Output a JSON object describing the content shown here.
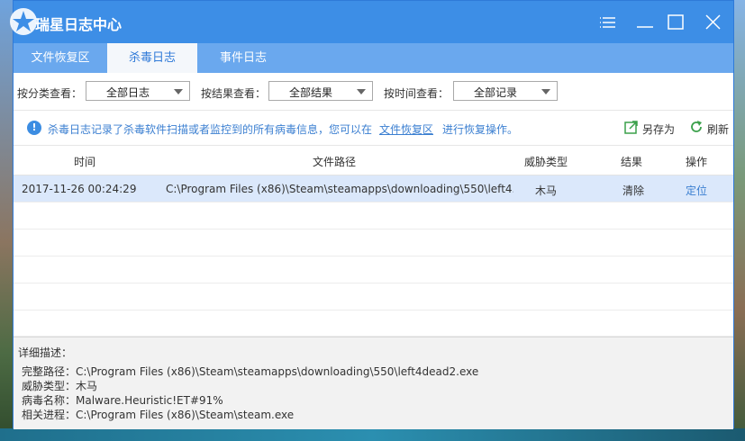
{
  "window": {
    "title": "瑞星日志中心",
    "controls": [
      "menu-icon",
      "minimize-icon",
      "maximize-icon",
      "close-icon"
    ]
  },
  "tabs": [
    {
      "label": "文件恢复区",
      "active": false
    },
    {
      "label": "杀毒日志",
      "active": true
    },
    {
      "label": "事件日志",
      "active": false
    }
  ],
  "filters": {
    "category": {
      "label": "按分类查看：",
      "value": "全部日志"
    },
    "result": {
      "label": "按结果查看：",
      "value": "全部结果"
    },
    "time": {
      "label": "按时间查看：",
      "value": "全部记录"
    }
  },
  "info": {
    "text": "杀毒日志记录了杀毒软件扫描或者监控到的所有病毒信息，您可以在",
    "link": "文件恢复区",
    "tail": "进行恢复操作。",
    "save_as": "另存为",
    "refresh": "刷新"
  },
  "table": {
    "columns": [
      "时间",
      "文件路径",
      "威胁类型",
      "结果",
      "操作"
    ],
    "rows": [
      {
        "time": "2017-11-26 00:24:29",
        "path": "C:\\Program Files (x86)\\Steam\\steamapps\\downloading\\550\\left4...",
        "threat": "木马",
        "result": "清除",
        "action": "定位",
        "selected": true
      }
    ]
  },
  "details": {
    "title": "详细描述：",
    "lines": [
      "完整路径：C:\\Program Files (x86)\\Steam\\steamapps\\downloading\\550\\left4dead2.exe",
      "威胁类型：木马",
      "病毒名称：Malware.Heuristic!ET#91%",
      "相关进程：C:\\Program Files (x86)\\Steam\\steam.exe"
    ]
  },
  "colors": {
    "titlebar": "#3d8ee6",
    "tabbar": "#6aa8ee",
    "accent": "#3b7fd1",
    "selected_row": "#dbe8fb"
  }
}
